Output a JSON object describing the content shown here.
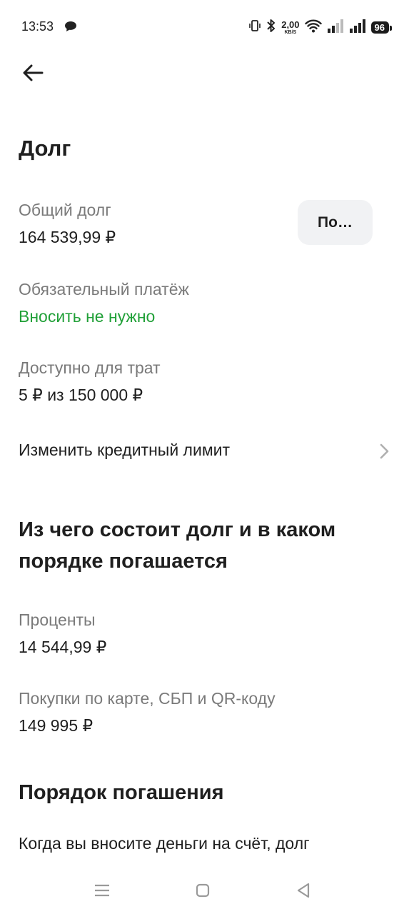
{
  "status_bar": {
    "time": "13:53",
    "speed_value": "2,00",
    "speed_unit": "KB/S",
    "battery": "96",
    "icons": [
      "chat-icon",
      "vibrate-icon",
      "bluetooth-icon",
      "wifi-icon",
      "signal-icon",
      "signal-icon",
      "battery-icon"
    ]
  },
  "header": {
    "back_icon": "arrow-left-icon"
  },
  "debt": {
    "title": "Долг",
    "total_label": "Общий долг",
    "total_value": "164 539,99 ₽",
    "pay_button_label": "По…",
    "mandatory_label": "Обязательный платёж",
    "mandatory_value": "Вносить не нужно",
    "available_label": "Доступно для трат",
    "available_value": "5 ₽ из 150 000 ₽",
    "change_limit_label": "Изменить кредитный лимит"
  },
  "composition": {
    "title": "Из чего состоит долг и в каком порядке погашается",
    "interest_label": "Проценты",
    "interest_value": "14 544,99 ₽",
    "purchases_label": "Покупки по карте, СБП и QR-коду",
    "purchases_value": "149 995 ₽"
  },
  "repayment": {
    "title": "Порядок погашения",
    "text": "Когда вы вносите деньги на счёт, долг"
  },
  "colors": {
    "accent_green": "#21a038",
    "muted": "#7a7a7a",
    "button_bg": "#f1f2f4"
  }
}
